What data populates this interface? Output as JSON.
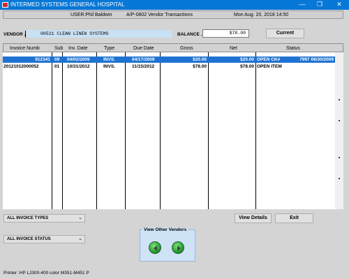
{
  "window": {
    "title": "INTERMED SYSTEMS GENERAL HOSPITAL"
  },
  "infobar": {
    "user": "USER:Phil Baldwin",
    "module": "A/P-0802   Vendor Transactions",
    "datetime": "Mon Aug. 20, 2018 14:50"
  },
  "vendor": {
    "label": "VENDOR .",
    "value": "00521  CLEAN LINEN SYSTEMS"
  },
  "balance": {
    "label": "BALANCE .",
    "value": "$78.00"
  },
  "buttons": {
    "current": "Current",
    "view_details": "View Details",
    "exit": "Exit"
  },
  "grid": {
    "columns": [
      "Invoice Numb",
      "Sub",
      "Inv. Date",
      "Type",
      "Due Date",
      "Gross",
      "Net",
      "Status"
    ],
    "rows": [
      {
        "invoice": "912341",
        "sub": "09",
        "inv_date": "04/02/2009",
        "type": "INVS.",
        "due_date": "04/17/2009",
        "gross": "$20.00",
        "net": "$20.00",
        "status": "OPEN CK#",
        "check": "7997 06/30/2009",
        "selected": true
      },
      {
        "invoice": "20121012000052",
        "sub": "01",
        "inv_date": "10/31/2012",
        "type": "INVS.",
        "due_date": "11/15/2012",
        "gross": "$78.00",
        "net": "$78.00",
        "status": "OPEN ITEM",
        "check": "",
        "selected": false
      }
    ]
  },
  "filters": {
    "invoice_types": "ALL INVOICE TYPES",
    "invoice_status": "ALL INVOICE STATUS"
  },
  "vendors_nav": {
    "title": "View Other Vendors"
  },
  "printer": "Printer :HP LJ300-400 color M351-M451 P",
  "colors": {
    "titlebar": "#0778d7",
    "selected_row": "#1e73d2",
    "vendor_field": "#c8e0f4",
    "nav_button": "#2bb13a"
  }
}
